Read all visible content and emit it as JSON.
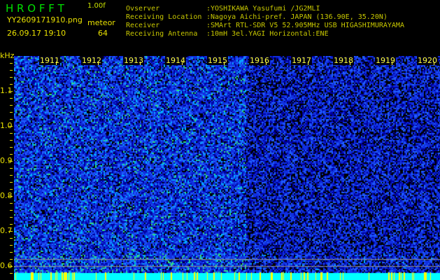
{
  "header": {
    "logo": "H R O F F T",
    "version": "1.00f",
    "filename": "YY2609171910.png",
    "datetime": "26.09.17 19:10",
    "mode_label": "meteor",
    "count": "64",
    "info_labels": [
      "Ovserver",
      "Receiving Location",
      "Receiver",
      "Receiving Antenna"
    ],
    "info_values": [
      ":YOSHIKAWA Yasufumi /JG2MLI",
      ":Nagoya Aichi-pref. JAPAN (136.90E, 35.20N)",
      ":SMArt RTL-SDR V5 52.905MHz USB HIGASHIMURAYAMA",
      ":10mH 3el.YAGI Horizontal:ENE"
    ]
  },
  "axis": {
    "unit": "kHz",
    "y_labels": [
      "1.1",
      "1.0",
      "0.9",
      "0.8",
      "0.7",
      "0.6"
    ],
    "minute_labels": [
      "1911",
      "1912",
      "1913",
      "1914",
      "1915",
      "1916",
      "1917",
      "1918",
      "1919",
      "1920"
    ]
  },
  "colors": {
    "text_yellow": "#e8e000",
    "logo_green": "#00e000",
    "noise_blue": "#2040ff",
    "baseline_cyan": "#00ffff"
  }
}
